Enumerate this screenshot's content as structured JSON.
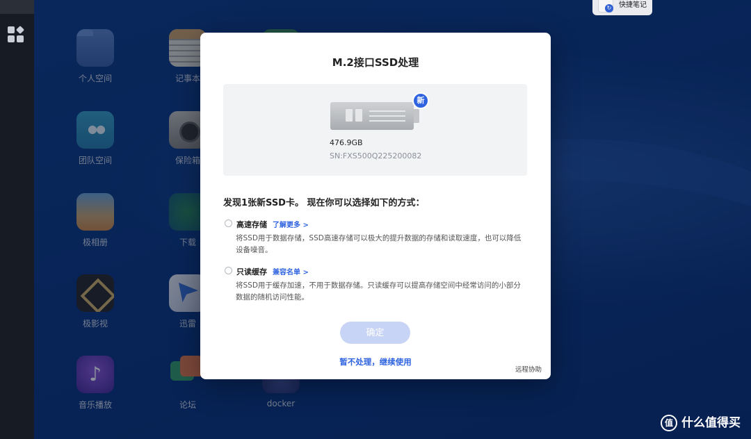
{
  "desktop": {
    "apps": [
      {
        "label": "个人空间",
        "icon": "folder-icon"
      },
      {
        "label": "团队空间",
        "icon": "team-folder-icon"
      },
      {
        "label": "极相册",
        "icon": "photos-icon"
      },
      {
        "label": "极影视",
        "icon": "video-icon"
      },
      {
        "label": "音乐播放",
        "icon": "music-icon"
      },
      {
        "label": "记事本",
        "icon": "notepad-icon"
      },
      {
        "label": "保险箱",
        "icon": "safe-icon"
      },
      {
        "label": "下载",
        "icon": "download-icon"
      },
      {
        "label": "迅雷",
        "icon": "thunder-icon"
      },
      {
        "label": "论坛",
        "icon": "forum-icon"
      },
      {
        "label": "docker",
        "icon": "docker-icon"
      }
    ]
  },
  "quick_note": {
    "label": "快捷笔记",
    "icon": "quick-note-icon"
  },
  "dialog": {
    "title": "M.2接口SSD处理",
    "ssd": {
      "badge": "新",
      "capacity": "476.9GB",
      "serial": "SN:FXS500Q225200082"
    },
    "found_text": "发现1张新SSD卡。 现在你可以选择如下的方式：",
    "options": [
      {
        "label": "高速存储",
        "link": "了解更多 >",
        "description": "将SSD用于数据存储，SSD高速存储可以极大的提升数据的存储和读取速度，也可以降低设备噪音。",
        "selected": false
      },
      {
        "label": "只读缓存",
        "link": "兼容名单 >",
        "description": "将SSD用于缓存加速，不用于数据存储。只读缓存可以提高存储空间中经常访问的小部分数据的随机访问性能。",
        "selected": false
      }
    ],
    "confirm_label": "确定",
    "skip_label": "暂不处理，继续使用",
    "remote_help_label": "远程协助"
  },
  "watermark": {
    "logo": "值",
    "text": "什么值得买"
  },
  "colors": {
    "accent": "#2f63e0",
    "confirm_disabled": "#c8d4f5",
    "sidebar": "#161b24"
  }
}
